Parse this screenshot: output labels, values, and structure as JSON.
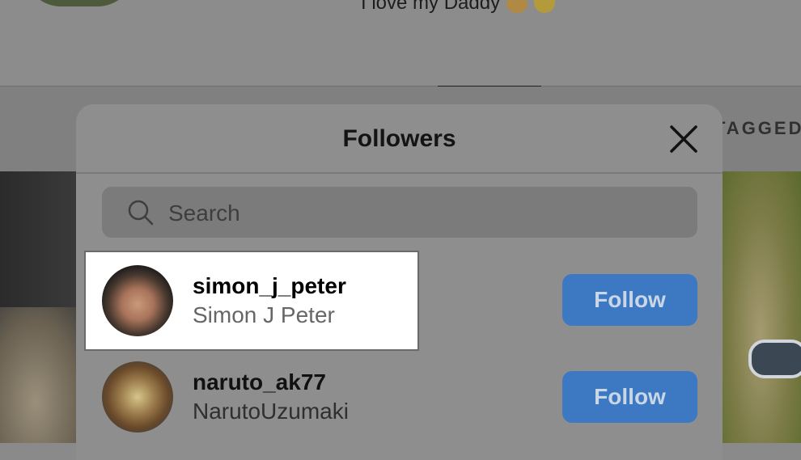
{
  "profile_background": {
    "bio": "I love my Daddy",
    "tagged_tab_label": "TAGGED"
  },
  "modal": {
    "title": "Followers",
    "close_icon": "close-icon",
    "search": {
      "placeholder": "Search",
      "icon": "search-icon"
    },
    "followers": [
      {
        "username": "simon_j_peter",
        "full_name": "Simon J Peter",
        "button_label": "Follow"
      },
      {
        "username": "naruto_ak77",
        "full_name": "NarutoUzumaki",
        "button_label": "Follow"
      }
    ]
  },
  "colors": {
    "follow_button": "#3d78c2",
    "overlay": "#8e8e8e",
    "highlight_background": "#ffffff"
  }
}
